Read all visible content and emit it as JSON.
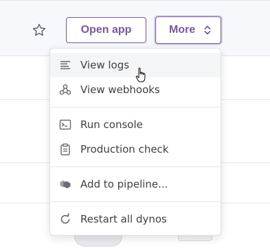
{
  "header": {
    "open_app_label": "Open app",
    "more_label": "More",
    "favorite_icon": "star-icon"
  },
  "menu": {
    "items": [
      {
        "label": "View logs",
        "icon": "logs-icon"
      },
      {
        "label": "View webhooks",
        "icon": "webhooks-icon"
      },
      {
        "label": "Run console",
        "icon": "console-icon"
      },
      {
        "label": "Production check",
        "icon": "clipboard-icon"
      },
      {
        "label": "Add to pipeline...",
        "icon": "pipeline-icon"
      },
      {
        "label": "Restart all dynos",
        "icon": "restart-icon"
      }
    ]
  },
  "colors": {
    "accent": "#79589f",
    "menu_text": "#3f3f44",
    "icon_gray": "#6b6e78",
    "header_bg": "#f7f8fb"
  }
}
